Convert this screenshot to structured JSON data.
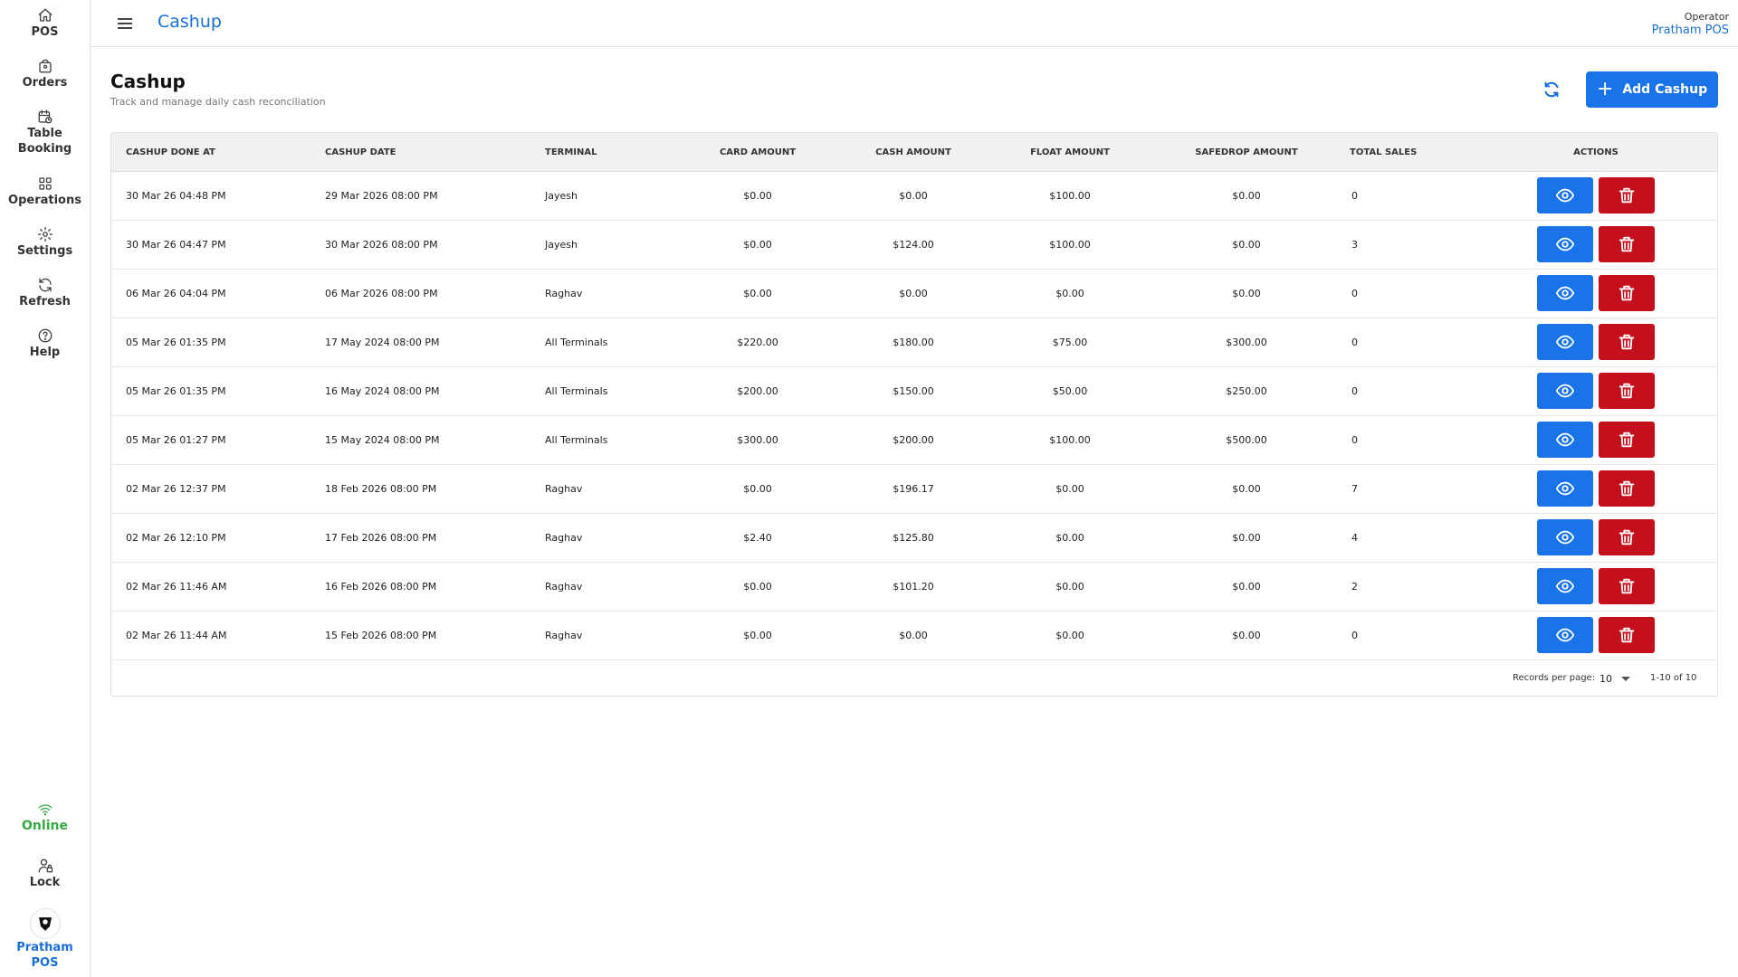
{
  "sidebar": {
    "items": [
      {
        "label": "POS",
        "icon": "home-icon"
      },
      {
        "label": "Orders",
        "icon": "shopping-bag-icon"
      },
      {
        "label": "Table Booking",
        "icon": "calendar-clock-icon"
      },
      {
        "label": "Operations",
        "icon": "grid-icon"
      },
      {
        "label": "Settings",
        "icon": "gear-icon"
      },
      {
        "label": "Refresh",
        "icon": "refresh-icon"
      },
      {
        "label": "Help",
        "icon": "help-circle-icon"
      }
    ],
    "status": {
      "label": "Online",
      "icon": "wifi-icon",
      "color": "#3aa845"
    },
    "lock": {
      "label": "Lock",
      "icon": "user-lock-icon"
    },
    "brand": {
      "label": "Pratham POS",
      "icon": "brand-logo-icon"
    }
  },
  "header": {
    "title": "Cashup",
    "operator_role": "Operator",
    "operator_name": "Pratham POS"
  },
  "page": {
    "title": "Cashup",
    "subtitle": "Track and manage daily cash reconciliation",
    "add_button_label": "Add Cashup"
  },
  "table": {
    "columns": [
      "CASHUP DONE AT",
      "CASHUP DATE",
      "TERMINAL",
      "CARD AMOUNT",
      "CASH AMOUNT",
      "FLOAT AMOUNT",
      "SAFEDROP AMOUNT",
      "TOTAL SALES",
      "ACTIONS"
    ],
    "rows": [
      {
        "done_at": "30 Mar 26 04:48 PM",
        "date": "29 Mar 2026 08:00 PM",
        "terminal": "Jayesh",
        "card": "$0.00",
        "cash": "$0.00",
        "float": "$100.00",
        "safedrop": "$0.00",
        "sales": "0"
      },
      {
        "done_at": "30 Mar 26 04:47 PM",
        "date": "30 Mar 2026 08:00 PM",
        "terminal": "Jayesh",
        "card": "$0.00",
        "cash": "$124.00",
        "float": "$100.00",
        "safedrop": "$0.00",
        "sales": "3"
      },
      {
        "done_at": "06 Mar 26 04:04 PM",
        "date": "06 Mar 2026 08:00 PM",
        "terminal": "Raghav",
        "card": "$0.00",
        "cash": "$0.00",
        "float": "$0.00",
        "safedrop": "$0.00",
        "sales": "0"
      },
      {
        "done_at": "05 Mar 26 01:35 PM",
        "date": "17 May 2024 08:00 PM",
        "terminal": "All Terminals",
        "card": "$220.00",
        "cash": "$180.00",
        "float": "$75.00",
        "safedrop": "$300.00",
        "sales": "0"
      },
      {
        "done_at": "05 Mar 26 01:35 PM",
        "date": "16 May 2024 08:00 PM",
        "terminal": "All Terminals",
        "card": "$200.00",
        "cash": "$150.00",
        "float": "$50.00",
        "safedrop": "$250.00",
        "sales": "0"
      },
      {
        "done_at": "05 Mar 26 01:27 PM",
        "date": "15 May 2024 08:00 PM",
        "terminal": "All Terminals",
        "card": "$300.00",
        "cash": "$200.00",
        "float": "$100.00",
        "safedrop": "$500.00",
        "sales": "0"
      },
      {
        "done_at": "02 Mar 26 12:37 PM",
        "date": "18 Feb 2026 08:00 PM",
        "terminal": "Raghav",
        "card": "$0.00",
        "cash": "$196.17",
        "float": "$0.00",
        "safedrop": "$0.00",
        "sales": "7"
      },
      {
        "done_at": "02 Mar 26 12:10 PM",
        "date": "17 Feb 2026 08:00 PM",
        "terminal": "Raghav",
        "card": "$2.40",
        "cash": "$125.80",
        "float": "$0.00",
        "safedrop": "$0.00",
        "sales": "4"
      },
      {
        "done_at": "02 Mar 26 11:46 AM",
        "date": "16 Feb 2026 08:00 PM",
        "terminal": "Raghav",
        "card": "$0.00",
        "cash": "$101.20",
        "float": "$0.00",
        "safedrop": "$0.00",
        "sales": "2"
      },
      {
        "done_at": "02 Mar 26 11:44 AM",
        "date": "15 Feb 2026 08:00 PM",
        "terminal": "Raghav",
        "card": "$0.00",
        "cash": "$0.00",
        "float": "$0.00",
        "safedrop": "$0.00",
        "sales": "0"
      }
    ]
  },
  "pagination": {
    "records_label": "Records per page:",
    "per_page": "10",
    "range": "1-10 of 10"
  },
  "colors": {
    "accent": "#1a73e8",
    "danger": "#c4101c",
    "online": "#3aa845"
  }
}
